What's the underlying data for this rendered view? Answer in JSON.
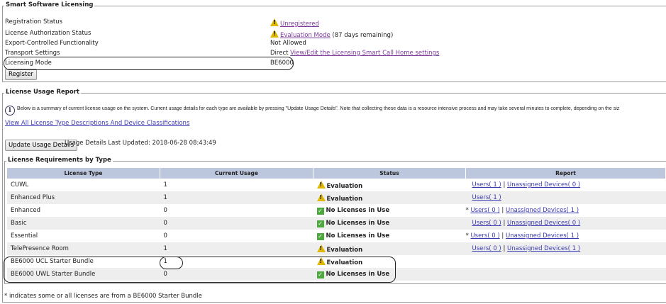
{
  "smart": {
    "title": "Smart Software Licensing",
    "rows": [
      {
        "label": "Registration Status",
        "link": "Unregistered"
      },
      {
        "label": "License Authorization Status",
        "link": "Evaluation Mode",
        "extra": "(87 days remaining)"
      },
      {
        "label": "Export-Controlled Functionality",
        "value": "Not Allowed"
      },
      {
        "label": "Transport Settings",
        "value": "Direct",
        "link": "View/Edit the Licensing Smart Call Home settings"
      },
      {
        "label": "Licensing Mode",
        "value": "BE6000"
      }
    ],
    "register": "Register"
  },
  "report": {
    "title": "License Usage Report",
    "info": "Below is a summary of current license usage on the system. Current usage details for each type are available by pressing \"Update Usage Details\". Note that collecting these data is a resource intensive process and may take several minutes to complete, depending on the siz",
    "link": "View All License Type Descriptions And Device Classifications",
    "update_button": "Update Usage Details",
    "last_updated": "Usage Details Last Updated: 2018-06-28 08:43:49",
    "req_title": "License Requirements by Type",
    "headers": [
      "License Type",
      "Current Usage",
      "Status",
      "Report"
    ],
    "rows": [
      {
        "type": "CUWL",
        "usage": "1",
        "status": "Evaluation",
        "icon": "warning",
        "star": "",
        "users": "Users( 1 )",
        "devices": "Unassigned Devices( 0 )"
      },
      {
        "type": "Enhanced Plus",
        "usage": "1",
        "status": "Evaluation",
        "icon": "warning",
        "star": "",
        "users": "Users( 1 )",
        "devices": ""
      },
      {
        "type": "Enhanced",
        "usage": "0",
        "status": "No Licenses in Use",
        "icon": "check",
        "star": "*",
        "users": "Users( 0 )",
        "devices": "Unassigned Devices( 1 )"
      },
      {
        "type": "Basic",
        "usage": "0",
        "status": "No Licenses in Use",
        "icon": "check",
        "star": "",
        "users": "Users( 0 )",
        "devices": "Unassigned Devices( 0 )"
      },
      {
        "type": "Essential",
        "usage": "0",
        "status": "No Licenses in Use",
        "icon": "check",
        "star": "*",
        "users": "Users( 0 )",
        "devices": "Unassigned Devices( 1 )"
      },
      {
        "type": "TelePresence Room",
        "usage": "1",
        "status": "Evaluation",
        "icon": "warning",
        "star": "",
        "users": "Users( 0 )",
        "devices": "Unassigned Devices( 1 )"
      },
      {
        "type": "BE6000 UCL Starter Bundle",
        "usage": "1",
        "status": "Evaluation",
        "icon": "warning",
        "star": "",
        "users": "",
        "devices": ""
      },
      {
        "type": "BE6000 UWL Starter Bundle",
        "usage": "0",
        "status": "No Licenses in Use",
        "icon": "check",
        "star": "",
        "users": "",
        "devices": ""
      }
    ],
    "footnote": "* indicates some or all licenses are from a BE6000 Starter Bundle"
  }
}
